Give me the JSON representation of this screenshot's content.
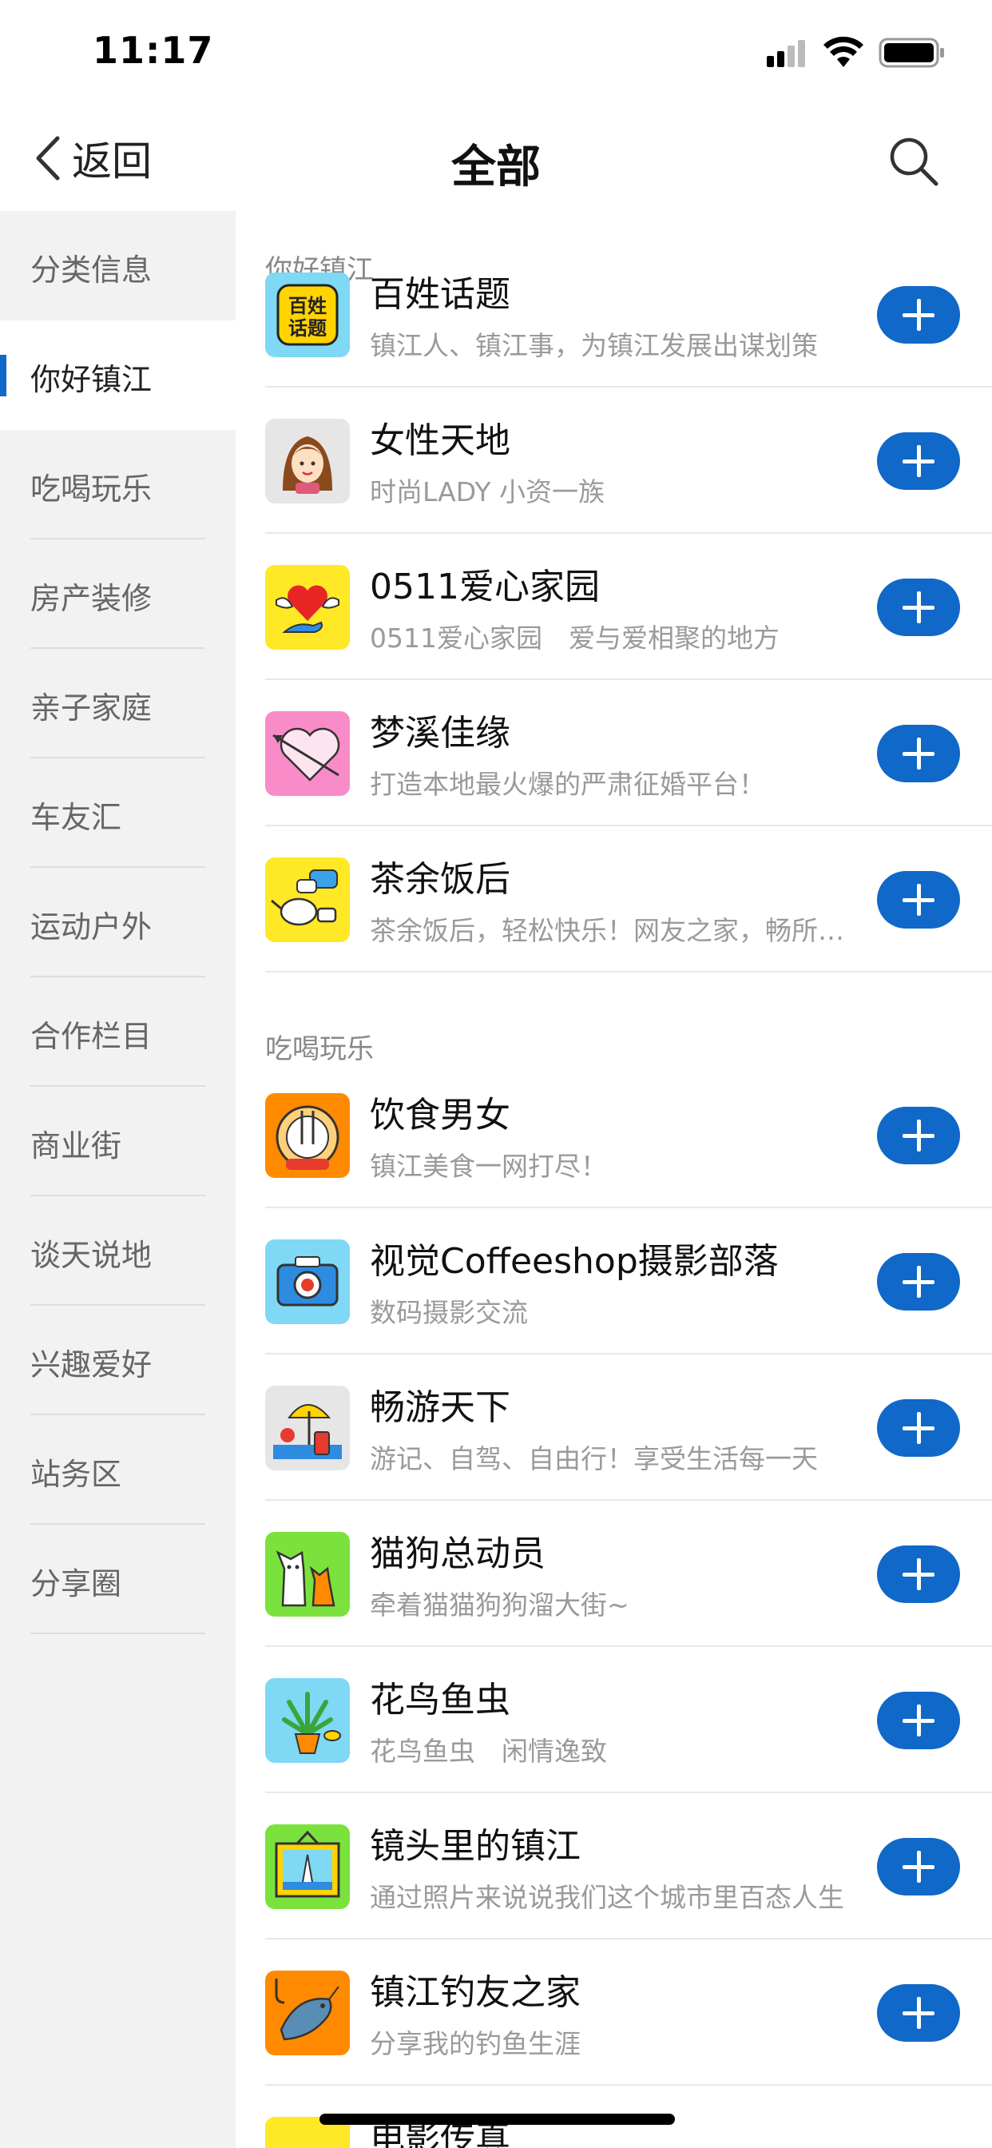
{
  "status_bar": {
    "time": "11:17"
  },
  "nav": {
    "back_label": "返回",
    "title": "全部"
  },
  "sidebar": {
    "items": [
      {
        "label": "分类信息"
      },
      {
        "label": "你好镇江",
        "active": true
      },
      {
        "label": "吃喝玩乐"
      },
      {
        "label": "房产装修"
      },
      {
        "label": "亲子家庭"
      },
      {
        "label": "车友汇"
      },
      {
        "label": "运动户外"
      },
      {
        "label": "合作栏目"
      },
      {
        "label": "商业街"
      },
      {
        "label": "谈天说地"
      },
      {
        "label": "兴趣爱好"
      },
      {
        "label": "站务区"
      },
      {
        "label": "分享圈"
      }
    ]
  },
  "sections": [
    {
      "header": "你好镇江",
      "rows": [
        {
          "title": "百姓话题",
          "desc": "镇江人、镇江事，为镇江发展出谋划策",
          "icon": "topic-badge-icon",
          "icon_label": "百姓\n话题"
        },
        {
          "title": "女性天地",
          "desc": "时尚LADY 小资一族",
          "icon": "woman-avatar-icon"
        },
        {
          "title": "0511爱心家园",
          "desc": "0511爱心家园　爱与爱相聚的地方",
          "icon": "heart-hand-icon"
        },
        {
          "title": "梦溪佳缘",
          "desc": "打造本地最火爆的严肃征婚平台！",
          "icon": "heart-arrow-icon"
        },
        {
          "title": "茶余饭后",
          "desc": "茶余饭后，轻松快乐！网友之家，畅所欲言",
          "icon": "teapot-chat-icon"
        }
      ]
    },
    {
      "header": "吃喝玩乐",
      "rows": [
        {
          "title": "饮食男女",
          "desc": "镇江美食一网打尽！",
          "icon": "dining-plate-icon"
        },
        {
          "title": "视觉Coffeeshop摄影部落",
          "desc": "数码摄影交流",
          "icon": "camera-icon"
        },
        {
          "title": "畅游天下",
          "desc": "游记、自驾、自由行！享受生活每一天",
          "icon": "beach-luggage-icon"
        },
        {
          "title": "猫狗总动员",
          "desc": "牵着猫猫狗狗溜大街~",
          "icon": "cat-dog-icon"
        },
        {
          "title": "花鸟鱼虫",
          "desc": "花鸟鱼虫　闲情逸致",
          "icon": "plant-fish-icon"
        },
        {
          "title": "镜头里的镇江",
          "desc": "通过照片来说说我们这个城市里百态人生",
          "icon": "framed-pagoda-icon"
        },
        {
          "title": "镇江钓友之家",
          "desc": "分享我的钓鱼生涯",
          "icon": "fish-hook-icon"
        },
        {
          "title": "电影传真",
          "desc": "",
          "icon": "film-icon"
        }
      ]
    }
  ],
  "colors": {
    "accent": "#1068c8",
    "sidebar_bg": "#f2f2f2",
    "muted_text": "#9a9a9a"
  }
}
